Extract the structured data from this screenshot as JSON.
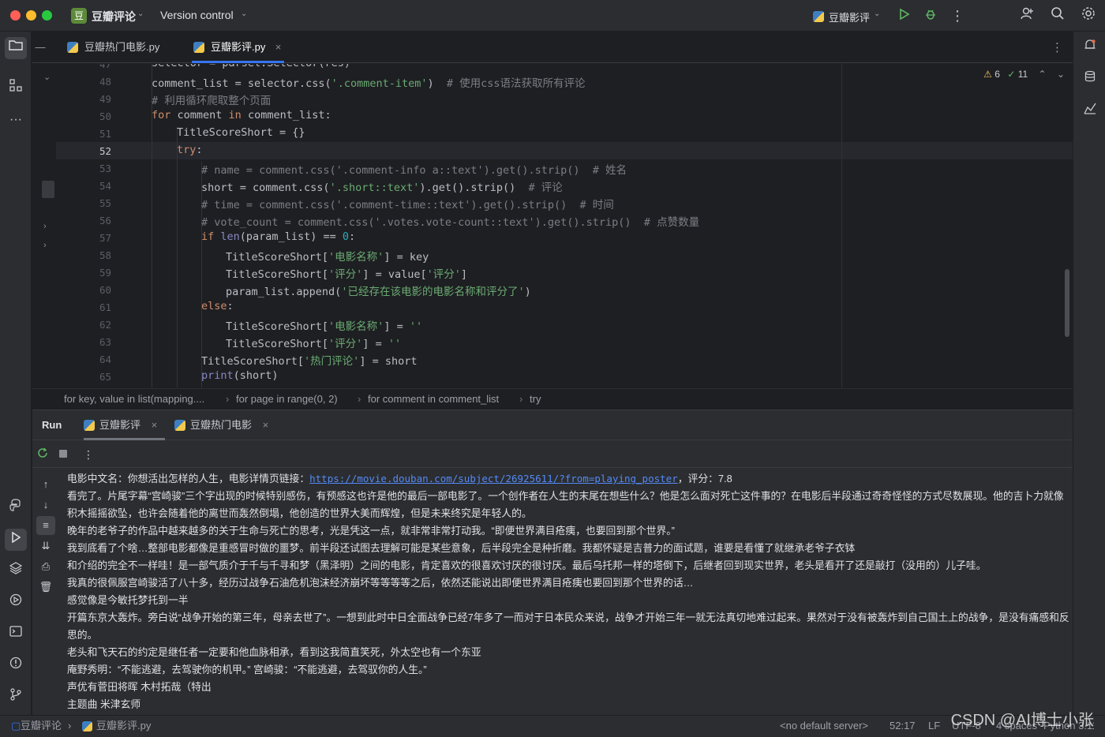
{
  "titlebar": {
    "project_badge": "豆",
    "project_name": "豆瓣评论",
    "vcs_label": "Version control",
    "run_config": "豆瓣影评"
  },
  "tabs": [
    {
      "label": "豆瓣热门电影.py"
    },
    {
      "label": "豆瓣影评.py"
    }
  ],
  "inspections": {
    "warnings": "6",
    "checks": "11"
  },
  "editor": {
    "line_numbers": [
      "47",
      "48",
      "49",
      "50",
      "51",
      "52",
      "53",
      "54",
      "55",
      "56",
      "57",
      "58",
      "59",
      "60",
      "61",
      "62",
      "63",
      "64",
      "65"
    ],
    "current_line": "52"
  },
  "breadcrumb": [
    "for key, value in list(mapping....",
    "for page in range(0, 2)",
    "for comment in comment_list",
    "try"
  ],
  "run": {
    "title": "Run",
    "tabs": [
      {
        "label": "豆瓣影评"
      },
      {
        "label": "豆瓣热门电影"
      }
    ]
  },
  "console": {
    "first_prefix": "电影中文名：你想活出怎样的人生，电影详情页链接：",
    "first_link": "https://movie.douban.com/subject/26925611/?from=playing_poster",
    "first_suffix": "，评分：7.8",
    "lines": [
      "看完了。片尾字幕“宫崎骏”三个字出现的时候特别感伤，有预感这也许是他的最后一部电影了。一个创作者在人生的末尾在想些什么？他是怎么面对死亡这件事的？在电影后半段通过奇奇怪怪的方式尽数展现。他的吉卜力就像积木摇摇欲坠，也许会随着他的离世而轰然倒塌，他创造的世界大美而辉煌，但是未来终究是年轻人的。",
      "晚年的老爷子的作品中越来越多的关于生命与死亡的思考，光是凭这一点，就非常非常打动我。“即便世界满目疮痍，也要回到那个世界。”",
      "我到底看了个啥…整部电影都像是重感冒时做的噩梦。前半段还试图去理解可能是某些意象，后半段完全是种折磨。我都怀疑是吉普力的面试题，谁要是看懂了就继承老爷子衣钵",
      "和介绍的完全不一样哇！是一部气质介于千与千寻和梦（黑泽明）之间的电影，肯定喜欢的很喜欢讨厌的很讨厌。最后乌托邦一样的塔倒下，后继者回到现实世界，老头是看开了还是敲打（没用的）儿子哇。",
      "我真的很佩服宫崎骏活了八十多，经历过战争石油危机泡沫经济崩坏等等等等之后，依然还能说出即便世界满目疮痍也要回到那个世界的话…",
      "感觉像是今敏托梦托到一半",
      "开篇东京大轰炸。旁白说“战争开始的第三年，母亲去世了”。一想到此时中日全面战争已经7年多了一而对于日本民众来说，战争才开始三年一就无法真切地难过起来。果然对于没有被轰炸到自己国土上的战争，是没有痛感和反思的。",
      "老头和飞天石的约定是继任者一定要和他血脉相承，看到这我简直笑死，外太空也有一个东亚",
      "庵野秀明：“不能逃避，去驾驶你的机甲。”  宫崎骏：“不能逃避，去驾驭你的人生。”",
      "声优有菅田将晖  木村拓哉（特出",
      "主题曲  米津玄师"
    ]
  },
  "statusbar": {
    "project": "豆瓣评论",
    "file": "豆瓣影评.py",
    "server": "<no default server>",
    "position": "52:17",
    "line_sep": "LF",
    "encoding": "UTF-8",
    "indent": "4 spaces",
    "python": "Python 3.11"
  },
  "watermark": "CSDN @AI博士小张"
}
